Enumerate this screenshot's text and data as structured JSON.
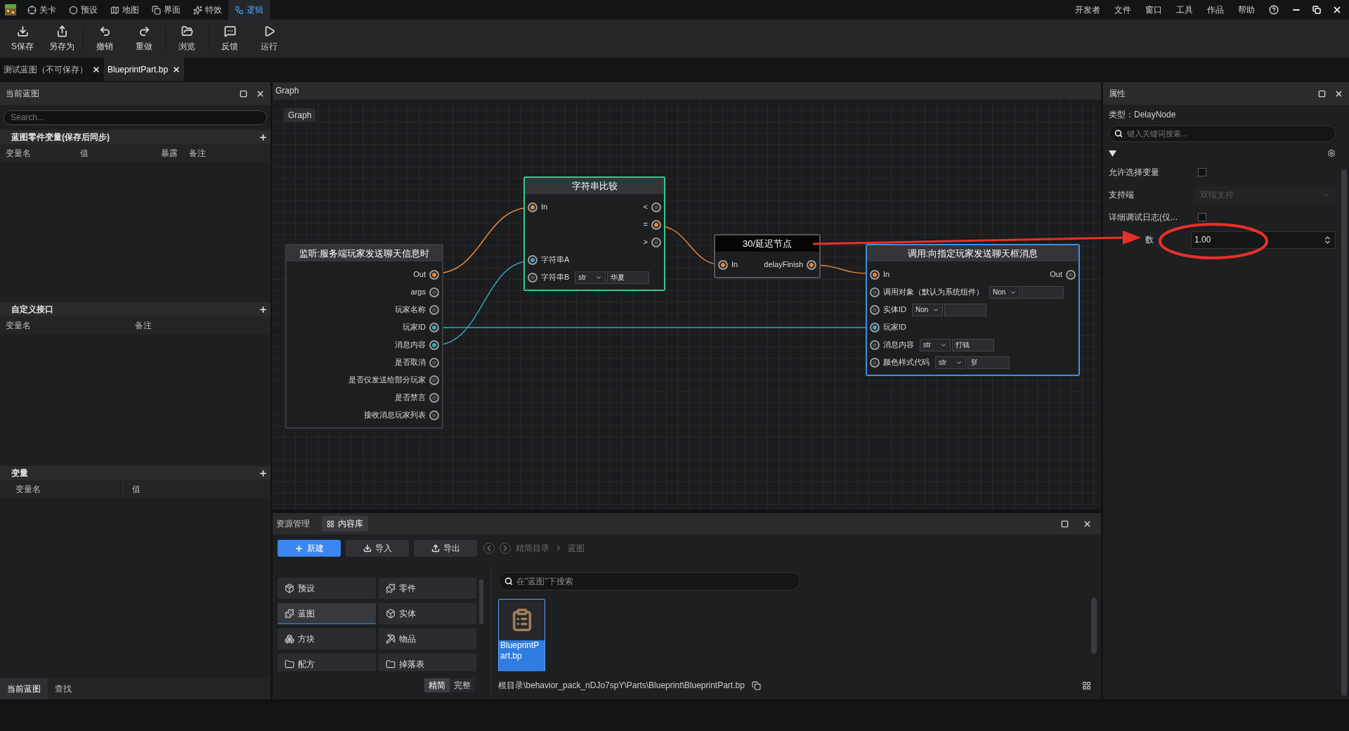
{
  "app_tabs": [
    {
      "label": "关卡",
      "selected": false
    },
    {
      "label": "预设",
      "selected": false
    },
    {
      "label": "地图",
      "selected": false
    },
    {
      "label": "界面",
      "selected": false
    },
    {
      "label": "特效",
      "selected": false
    },
    {
      "label": "逻辑",
      "selected": true
    }
  ],
  "menu": [
    "开发者",
    "文件",
    "窗口",
    "工具",
    "作品",
    "帮助"
  ],
  "toolbar": [
    "S保存",
    "另存为",
    "撤销",
    "重做",
    "浏览",
    "反馈",
    "运行"
  ],
  "doc_tabs": [
    {
      "label": "测试蓝图（不可保存）",
      "selected": false
    },
    {
      "label": "BlueprintPart.bp",
      "selected": true
    }
  ],
  "left_panel": {
    "title": "当前蓝图",
    "search_placeholder": "Search...",
    "sections": [
      {
        "title": "蓝图零件变量(保存后同步)",
        "columns": [
          "变量名",
          "值",
          "暴露",
          "备注"
        ]
      },
      {
        "title": "自定义接口",
        "columns": [
          "变量名",
          "备注"
        ]
      },
      {
        "title": "变量",
        "columns": [
          "变量名",
          "值"
        ]
      }
    ],
    "bottom_tabs": [
      {
        "label": "当前蓝图",
        "selected": true
      },
      {
        "label": "查找",
        "selected": false
      }
    ]
  },
  "graph": {
    "title": "Graph",
    "breadcrumb": "Graph",
    "nodes": [
      {
        "title": "监听:服务端玩家发送聊天信息时",
        "kind": "event",
        "color": "#3a3b3e",
        "rows": [
          {
            "right": {
              "label": "Out",
              "color": "#e8873a"
            }
          },
          {
            "right": {
              "label": "args",
              "color": "#4a4b4e"
            }
          },
          {
            "right": {
              "label": "玩家名称",
              "color": "#4a4b4e"
            }
          },
          {
            "right": {
              "label": "玩家ID",
              "color": "#38a9bd"
            }
          },
          {
            "right": {
              "label": "消息内容",
              "color": "#38a9bd"
            }
          },
          {
            "right": {
              "label": "是否取消",
              "color": "#4a4b4e"
            }
          },
          {
            "right": {
              "label": "是否仅发送给部分玩家",
              "color": "#4a4b4e"
            }
          },
          {
            "right": {
              "label": "是否禁言",
              "color": "#4a4b4e"
            }
          },
          {
            "right": {
              "label": "接收消息玩家列表",
              "color": "#4a4b4e"
            }
          }
        ]
      },
      {
        "title": "字符串比较",
        "kind": "compare",
        "color": "#36c98a",
        "rows": [
          {
            "left": {
              "label": "In",
              "color": "#e8873a"
            },
            "right": {
              "label": "<",
              "color": "#4a4b4e"
            }
          },
          {
            "right": {
              "label": "=",
              "color": "#e8873a"
            }
          },
          {
            "right": {
              "label": ">",
              "color": "#4a4b4e"
            }
          },
          {
            "left": {
              "label": "字符串A",
              "color": "#38a9bd"
            }
          },
          {
            "left": {
              "label": "字符串B",
              "color": "#4a4b4e"
            },
            "editor": {
              "select": "str",
              "value": "华夏"
            }
          }
        ]
      },
      {
        "title": "30/延迟节点",
        "kind": "delay",
        "color": "#55565a",
        "rows": [
          {
            "left": {
              "label": "In",
              "color": "#e8873a"
            },
            "right": {
              "label": "delayFinish",
              "color": "#e8873a"
            }
          }
        ]
      },
      {
        "title": "调用:向指定玩家发送聊天框消息",
        "kind": "call",
        "color": "#3d8fe8",
        "rows": [
          {
            "left": {
              "label": "In",
              "color": "#e8873a"
            },
            "right": {
              "label": "Out",
              "color": "#4a4b4e"
            }
          },
          {
            "left": {
              "label": "调用对象（默认为系统组件）",
              "color": "#4a4b4e"
            },
            "editor": {
              "select": "Non"
            }
          },
          {
            "left": {
              "label": "实体ID",
              "color": "#4a4b4e"
            },
            "editor": {
              "select": "Non"
            }
          },
          {
            "left": {
              "label": "玩家ID",
              "color": "#38a9bd"
            }
          },
          {
            "left": {
              "label": "消息内容",
              "color": "#4a4b4e"
            },
            "editor": {
              "select": "str",
              "value": "打钱"
            }
          },
          {
            "left": {
              "label": "颜色样式代码",
              "color": "#4a4b4e"
            },
            "editor": {
              "select": "str",
              "value": "§f"
            }
          }
        ]
      }
    ]
  },
  "properties": {
    "title": "属性",
    "type_text": "类型：DelayNode",
    "search_placeholder": "键入关键词搜索...",
    "rows": [
      {
        "kind": "checkbox",
        "label": "允许选择变量",
        "checked": false
      },
      {
        "kind": "select",
        "label": "支持端",
        "value": "双端支持",
        "disabled": true
      },
      {
        "kind": "checkbox",
        "label": "详细调试日志(仅...",
        "checked": false
      },
      {
        "kind": "number",
        "label": "数",
        "value": "1.00"
      }
    ]
  },
  "assets": {
    "tabs": [
      {
        "label": "资源管理",
        "selected": false
      },
      {
        "label": "内容库",
        "selected": true
      }
    ],
    "buttons": [
      {
        "label": "新建",
        "kind": "primary"
      },
      {
        "label": "导入",
        "kind": "import"
      },
      {
        "label": "导出",
        "kind": "export"
      }
    ],
    "breadcrumb": [
      "精简目录",
      "蓝图"
    ],
    "search_placeholder": "在\"蓝图\"下搜索",
    "categories": [
      {
        "label": "预设",
        "selected": false
      },
      {
        "label": "零件",
        "selected": false
      },
      {
        "label": "蓝图",
        "selected": true
      },
      {
        "label": "实体",
        "selected": false
      },
      {
        "label": "方块",
        "selected": false
      },
      {
        "label": "物品",
        "selected": false
      },
      {
        "label": "配方",
        "selected": false
      },
      {
        "label": "掉落表",
        "selected": false
      }
    ],
    "files": [
      {
        "label": "BlueprintPart.bp",
        "selected": true
      }
    ],
    "view_modes": [
      {
        "label": "精简",
        "selected": true
      },
      {
        "label": "完整",
        "selected": false
      }
    ],
    "path": "根目录\\behavior_pack_nDJo7spY\\Parts\\Blueprint\\BlueprintPart.bp"
  }
}
